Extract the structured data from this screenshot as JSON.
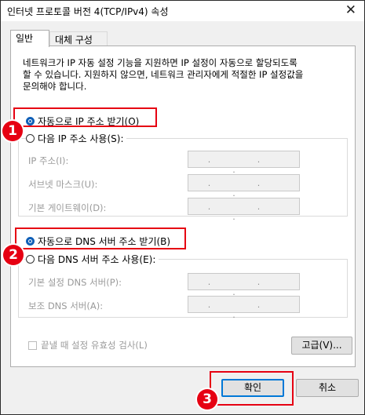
{
  "window": {
    "title": "인터넷 프로토콜 버전 4(TCP/IPv4) 속성",
    "close_glyph": "✕"
  },
  "tabs": [
    {
      "label": "일반",
      "active": true
    },
    {
      "label": "대체 구성",
      "active": false
    }
  ],
  "description": {
    "line1": "네트워크가 IP 자동 설정 기능을 지원하면 IP 설정이 자동으로 할당되도록",
    "line2": "할 수 있습니다. 지원하지 않으면, 네트워크 관리자에게 적절한 IP 설정값을",
    "line3": "문의해야 합니다."
  },
  "ip_section": {
    "auto_label": "자동으로 IP 주소 받기(O)",
    "auto_selected": true,
    "manual_label": "다음 IP 주소 사용(S):",
    "manual_selected": false,
    "fields": [
      {
        "label": "IP 주소(I):",
        "value": ". . ."
      },
      {
        "label": "서브넷 마스크(U):",
        "value": ". . ."
      },
      {
        "label": "기본 게이트웨이(D):",
        "value": ". . ."
      }
    ]
  },
  "dns_section": {
    "auto_label": "자동으로 DNS 서버 주소 받기(B)",
    "auto_selected": true,
    "manual_label": "다음 DNS 서버 주소 사용(E):",
    "manual_selected": false,
    "fields": [
      {
        "label": "기본 설정 DNS 서버(P):",
        "value": ". . ."
      },
      {
        "label": "보조 DNS 서버(A):",
        "value": ". . ."
      }
    ]
  },
  "validate_label": "끝낼 때 설정 유효성 검사(L)",
  "validate_checked": false,
  "advanced_label": "고급(V)...",
  "ok_label": "확인",
  "cancel_label": "취소",
  "callouts": [
    "1",
    "2",
    "3"
  ],
  "colors": {
    "highlight": "#e60012",
    "radio_accent": "#0f5fb7",
    "primary_button_border": "#0078d7"
  }
}
